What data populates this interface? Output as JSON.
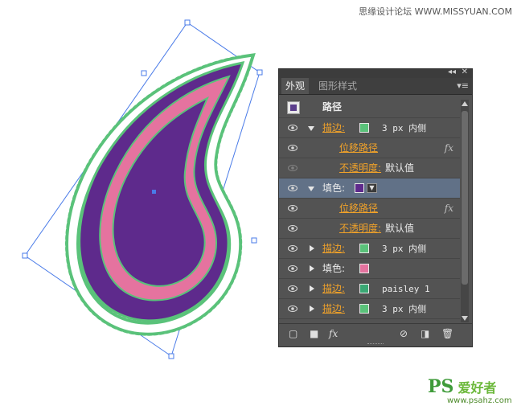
{
  "watermark_top": "思缘设计论坛 WWW.MISSYUAN.COM",
  "watermark_bottom": {
    "ps": "PS",
    "cn": "爱好者",
    "url": "www.psahz.com"
  },
  "colors": {
    "purple": "#5e2a8c",
    "pink": "#e5739f",
    "green": "#5ac27a",
    "teal": "#3aa874",
    "panel": "#535353",
    "selected": "#617187"
  },
  "panel": {
    "tabs": [
      "外观",
      "图形样式"
    ],
    "header": "路径",
    "rows": [
      {
        "type": "stroke",
        "label": "描边:",
        "swatch": "#5ac27a",
        "value": "3 px  内侧",
        "expanded": true
      },
      {
        "type": "effect",
        "label": "位移路径",
        "fx": "fx"
      },
      {
        "type": "opacity",
        "label": "不透明度:",
        "value": "默认值"
      },
      {
        "type": "fill",
        "label": "填色:",
        "swatch": "#5e2a8c",
        "expanded": true,
        "selected": true
      },
      {
        "type": "effect",
        "label": "位移路径",
        "fx": "fx"
      },
      {
        "type": "opacity",
        "label": "不透明度:",
        "value": "默认值"
      },
      {
        "type": "stroke",
        "label": "描边:",
        "swatch": "#5ac27a",
        "value": "3 px  内侧"
      },
      {
        "type": "fill",
        "label": "填色:",
        "swatch": "#e5739f"
      },
      {
        "type": "stroke",
        "label": "描边:",
        "swatch": "#3aa874",
        "value": "paisley 1"
      },
      {
        "type": "stroke",
        "label": "描边:",
        "swatch": "#5ac27a",
        "value": "3 px  内侧"
      }
    ],
    "bottom_icons": [
      "new-stroke-icon",
      "new-fill-icon",
      "fx-icon",
      "clear-icon",
      "duplicate-icon",
      "delete-icon"
    ],
    "fx_label": "fx"
  }
}
